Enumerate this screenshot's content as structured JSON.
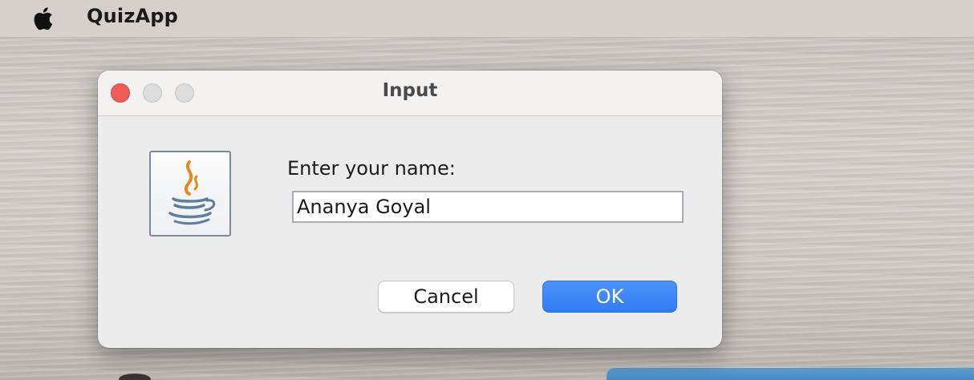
{
  "menubar": {
    "apple_icon": "apple-logo-icon",
    "app_name": "QuizApp"
  },
  "dialog": {
    "title": "Input",
    "window_controls": [
      "close",
      "minimize",
      "maximize"
    ],
    "icon": "java-coffee-cup-icon",
    "prompt": "Enter your name:",
    "input_value": "Ananya Goyal",
    "cancel_label": "Cancel",
    "ok_label": "OK"
  },
  "colors": {
    "close_button": "#ee5d57",
    "ok_button": "#2f7cf6",
    "dialog_background": "#ececec"
  }
}
